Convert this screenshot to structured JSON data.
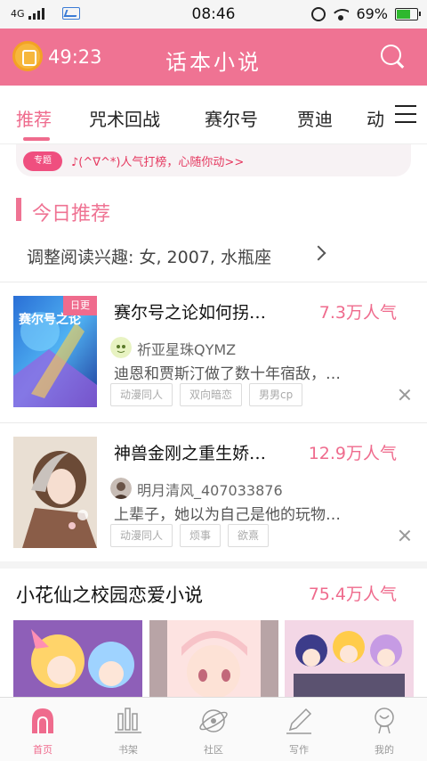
{
  "status_bar": {
    "network": "4G",
    "time": "08:46",
    "battery": "69%",
    "battery_level": 0.69
  },
  "header": {
    "timer": "49:23",
    "title": "话本小说"
  },
  "tabs": [
    {
      "label": "推荐",
      "active": true
    },
    {
      "label": "咒术回战",
      "active": false
    },
    {
      "label": "赛尔号",
      "active": false
    },
    {
      "label": "贾迪",
      "active": false
    },
    {
      "label": "动:",
      "active": false
    }
  ],
  "notice": {
    "tag": "专题",
    "text": "♪(^∇^*)人气打榜，心随你动>>"
  },
  "section": {
    "title": "今日推荐",
    "preference": "调整阅读兴趣: 女, 2007, 水瓶座"
  },
  "books": [
    {
      "badge": "日更",
      "cover_text": "赛尔号之论",
      "title": "赛尔号之论如何拐…",
      "popularity": "7.3万人气",
      "author": "祈亚星珠QYMZ",
      "description": "迪恩和贾斯汀做了数十年宿敌，…",
      "tags": [
        "动漫同人",
        "双向暗恋",
        "男男cp"
      ]
    },
    {
      "title": "神兽金刚之重生娇…",
      "popularity": "12.9万人气",
      "author": "明月清风_407033876",
      "description": "上辈子，她以为自己是他的玩物…",
      "tags": [
        "动漫同人",
        "烦事",
        "欲熹"
      ]
    }
  ],
  "section2": {
    "title": "小花仙之校园恋爱小说",
    "popularity": "75.4万人气"
  },
  "bottom_nav": [
    {
      "label": "首页",
      "icon": "home-icon",
      "active": true
    },
    {
      "label": "书架",
      "icon": "bookshelf-icon",
      "active": false
    },
    {
      "label": "社区",
      "icon": "community-icon",
      "active": false
    },
    {
      "label": "写作",
      "icon": "pen-icon",
      "active": false
    },
    {
      "label": "我的",
      "icon": "profile-icon",
      "active": false
    }
  ],
  "colors": {
    "brand": "#ef7393",
    "accent": "#ef6b8d",
    "timer": "#f6b73c"
  }
}
